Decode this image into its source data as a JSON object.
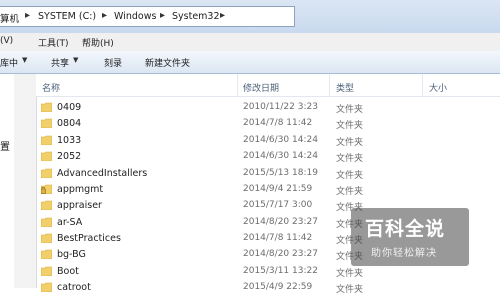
{
  "address": {
    "prefix": "算机",
    "crumbs": [
      "SYSTEM (C:)",
      "Windows",
      "System32"
    ]
  },
  "menu": [
    "(V)",
    "工具(T)",
    "帮助(H)"
  ],
  "toolbar": {
    "buttons": [
      "库中",
      "共享",
      "刻录",
      "新建文件夹"
    ]
  },
  "navpane": {
    "label": "置"
  },
  "columns": {
    "name": "名称",
    "date": "修改日期",
    "type": "类型",
    "size": "大小"
  },
  "files": [
    {
      "name": "0409",
      "date": "2010/11/22 3:23",
      "type": "文件夹",
      "icon": "folder-icon"
    },
    {
      "name": "0804",
      "date": "2014/7/8 11:42",
      "type": "文件夹",
      "icon": "folder-icon"
    },
    {
      "name": "1033",
      "date": "2014/6/30 14:24",
      "type": "文件夹",
      "icon": "folder-icon"
    },
    {
      "name": "2052",
      "date": "2014/6/30 14:24",
      "type": "文件夹",
      "icon": "folder-icon"
    },
    {
      "name": "AdvancedInstallers",
      "date": "2015/5/13 18:19",
      "type": "文件夹",
      "icon": "folder-icon"
    },
    {
      "name": "appmgmt",
      "date": "2014/9/4 21:59",
      "type": "文件夹",
      "icon": "locked-folder-icon"
    },
    {
      "name": "appraiser",
      "date": "2015/7/17 3:00",
      "type": "文件夹",
      "icon": "folder-icon"
    },
    {
      "name": "ar-SA",
      "date": "2014/8/20 23:27",
      "type": "文件夹",
      "icon": "folder-icon"
    },
    {
      "name": "BestPractices",
      "date": "2014/7/8 11:42",
      "type": "文件夹",
      "icon": "folder-icon"
    },
    {
      "name": "bg-BG",
      "date": "2014/8/20 23:27",
      "type": "文件夹",
      "icon": "folder-icon"
    },
    {
      "name": "Boot",
      "date": "2015/3/11 13:22",
      "type": "文件夹",
      "icon": "folder-icon"
    },
    {
      "name": "catroot",
      "date": "2015/4/9 22:59",
      "type": "文件夹",
      "icon": "folder-icon"
    }
  ],
  "watermark": {
    "title": "百科全说",
    "subtitle": "助你轻松解决"
  },
  "colors": {
    "folder": "#f1cf6a",
    "folder_dark": "#d9a93a",
    "header_text": "#4c607a"
  }
}
